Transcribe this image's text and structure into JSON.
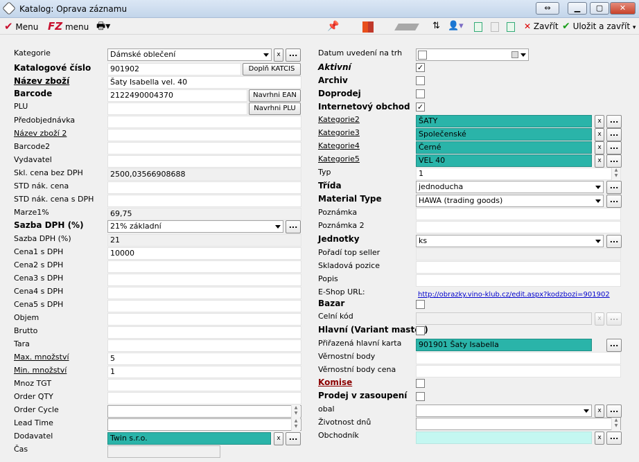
{
  "window": {
    "title": "Katalog: Oprava záznamu"
  },
  "toolbar": {
    "menu1": "Menu",
    "menu2_logo": "FZ",
    "menu2": "menu",
    "close": "Zavřít",
    "save_close": "Uložit a zavřít"
  },
  "left": {
    "kategorie": {
      "label": "Kategorie",
      "value": "Dámské oblečení"
    },
    "katalogove_cislo": {
      "label": "Katalogové číslo",
      "value": "901902",
      "button": "Doplň KATCIS"
    },
    "nazev_zbozi": {
      "label": "Název zboží",
      "value": "Šaty Isabella  vel. 40"
    },
    "barcode": {
      "label": "Barcode",
      "value": "2122490004370",
      "button": "Navrhni EAN"
    },
    "plu": {
      "label": "PLU",
      "value": "",
      "button": "Navrhni PLU"
    },
    "predobjednavka": {
      "label": "Předobjednávka",
      "value": ""
    },
    "nazev_zbozi2": {
      "label": "Název zboží 2",
      "value": ""
    },
    "barcode2": {
      "label": "Barcode2",
      "value": ""
    },
    "vydavatel": {
      "label": "Vydavatel",
      "value": ""
    },
    "skl_cena": {
      "label": "Skl. cena bez DPH",
      "value": "2500,03566908688"
    },
    "std_nak_cena": {
      "label": "STD nák. cena",
      "value": ""
    },
    "std_nak_cena_dph": {
      "label": "STD nák. cena s DPH",
      "value": ""
    },
    "marze": {
      "label": "Marze1%",
      "value": "69,75"
    },
    "sazba_dph_sel": {
      "label": "Sazba DPH (%)",
      "value": "21% základní"
    },
    "sazba_dph": {
      "label": "Sazba DPH (%)",
      "value": "21"
    },
    "cena1": {
      "label": "Cena1 s DPH",
      "value": "10000"
    },
    "cena2": {
      "label": "Cena2 s DPH",
      "value": ""
    },
    "cena3": {
      "label": "Cena3 s DPH",
      "value": ""
    },
    "cena4": {
      "label": "Cena4 s DPH",
      "value": ""
    },
    "cena5": {
      "label": "Cena5 s DPH",
      "value": ""
    },
    "objem": {
      "label": "Objem",
      "value": ""
    },
    "brutto": {
      "label": "Brutto",
      "value": ""
    },
    "tara": {
      "label": "Tara",
      "value": ""
    },
    "max_mnozstvi": {
      "label": "Max. množství",
      "value": "5"
    },
    "min_mnozstvi": {
      "label": "Min. množství",
      "value": "1"
    },
    "mnoz_tgt": {
      "label": "Mnoz TGT",
      "value": ""
    },
    "order_qty": {
      "label": "Order QTY",
      "value": ""
    },
    "order_cycle": {
      "label": "Order Cycle",
      "value": ""
    },
    "lead_time": {
      "label": "Lead Time",
      "value": ""
    },
    "dodavatel": {
      "label": "Dodavatel",
      "value": "Twin s.r.o."
    },
    "cas": {
      "label": "Čas",
      "value": ""
    }
  },
  "right": {
    "datum": {
      "label": "Datum uvedení na trh",
      "value": ""
    },
    "aktivni": {
      "label": "Aktivní",
      "checked": true
    },
    "archiv": {
      "label": "Archiv",
      "checked": false
    },
    "doprodej": {
      "label": "Doprodej",
      "checked": false
    },
    "internet": {
      "label": "Internetový obchod",
      "checked": true
    },
    "kategorie2": {
      "label": "Kategorie2",
      "value": "ŠATY"
    },
    "kategorie3": {
      "label": "Kategorie3",
      "value": "Společenské"
    },
    "kategorie4": {
      "label": "Kategorie4",
      "value": "Černé"
    },
    "kategorie5": {
      "label": "Kategorie5",
      "value": "VEL 40"
    },
    "typ": {
      "label": "Typ",
      "value": "1"
    },
    "trida": {
      "label": "Třída",
      "value": "jednoducha"
    },
    "material_type": {
      "label": "Material Type",
      "value": "HAWA (trading goods)"
    },
    "poznamka": {
      "label": "Poznámka",
      "value": ""
    },
    "poznamka2": {
      "label": "Poznámka 2",
      "value": ""
    },
    "jednotky": {
      "label": "Jednotky",
      "value": "ks"
    },
    "poradi": {
      "label": "Pořadí top seller",
      "value": ""
    },
    "skladova_pozice": {
      "label": "Skladová pozice",
      "value": ""
    },
    "popis": {
      "label": "Popis",
      "value": ""
    },
    "eshop_url": {
      "label": "E-Shop URL:",
      "value": "http://obrazky.vino-klub.cz/edit.aspx?kodzbozi=901902"
    },
    "bazar": {
      "label": "Bazar",
      "checked": false
    },
    "celni_kod": {
      "label": "Celní kód",
      "value": ""
    },
    "hlavni": {
      "label": "Hlavní (Variant master)",
      "checked": false
    },
    "prirazena": {
      "label": "Přiřazená hlavní karta",
      "value": "901901 Šaty Isabella"
    },
    "vernostni_body": {
      "label": "Věrnostní body",
      "value": ""
    },
    "vernostni_body_cena": {
      "label": "Věrnostní body cena",
      "value": ""
    },
    "komise": {
      "label": "Komise",
      "checked": false
    },
    "prodej": {
      "label": "Prodej v zasoupení",
      "checked": false
    },
    "obal": {
      "label": "obal",
      "value": ""
    },
    "zivotnost": {
      "label": "Životnost dnů",
      "value": ""
    },
    "obchodnik": {
      "label": "Obchodník",
      "value": ""
    }
  },
  "glyphs": {
    "x": "x",
    "dots": "...",
    "check": "✓",
    "up": "▲",
    "down": "▼"
  }
}
